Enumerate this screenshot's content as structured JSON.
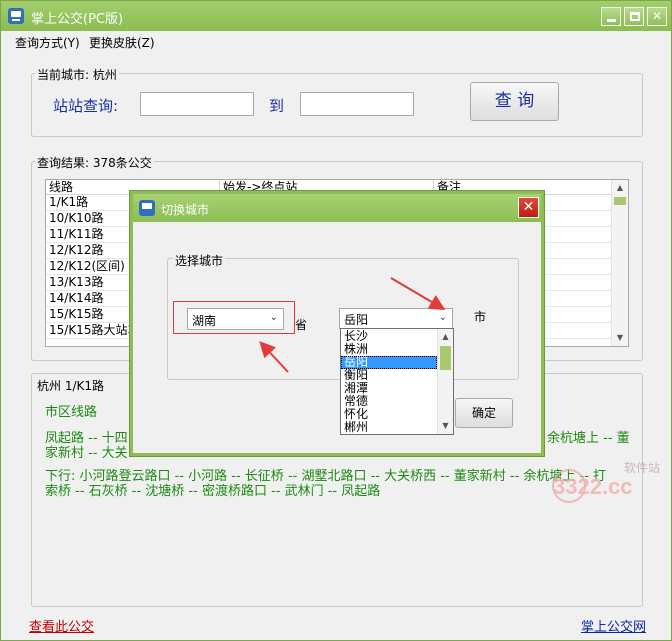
{
  "window": {
    "title": "掌上公交(PC版)"
  },
  "menu": [
    "查询方式(Y)",
    "更换皮肤(Z)"
  ],
  "current_city": {
    "legend": "当前城市: 杭州",
    "station_label": "站站查询:",
    "to_label": "到",
    "from_value": "",
    "to_value": "",
    "query_button": "查 询"
  },
  "results": {
    "legend": "查询结果: 378条公交",
    "columns": [
      "线路",
      "始发->终点站",
      "备注"
    ],
    "rows": [
      {
        "line": "1/K1路"
      },
      {
        "line": "10/K10路"
      },
      {
        "line": "11/K11路"
      },
      {
        "line": "12/K12路"
      },
      {
        "line": "12/K12(区间)"
      },
      {
        "line": "13/K13路"
      },
      {
        "line": "14/K14路"
      },
      {
        "line": "15/K15路"
      },
      {
        "line": "15/K15路大站车"
      }
    ]
  },
  "detail": {
    "legend": "杭州 1/K1路",
    "legend_extra": "〔",
    "district": "市区线路",
    "up_line1_left": "凤起路 -- 十四",
    "up_line2_left": "家新村 -- 大关",
    "up_line1_right": "余杭塘上 -- 董",
    "down_line1": "下行:    小河路登云路口 -- 小河路 -- 长征桥 -- 湖墅北路口 -- 大关桥西 -- 董家新村 -- 余杭塘上 -- 打",
    "down_line2": "索桥 -- 石灰桥 -- 沈塘桥 -- 密渡桥路口 -- 武林门 -- 凤起路"
  },
  "footer": {
    "view_link": "查看此公交",
    "brand_link": "掌上公交网"
  },
  "dialog": {
    "title": "切换城市",
    "group_label": "选择城市",
    "province_value": "湖南",
    "province_unit": "省",
    "city_value": "岳阳",
    "city_unit": "市",
    "confirm_button": "确定",
    "city_options": [
      "长沙",
      "株洲",
      "岳阳",
      "衡阳",
      "湘潭",
      "常德",
      "怀化",
      "郴州"
    ],
    "selected_index": 2
  },
  "watermark": {
    "brand": "3322.cc",
    "tag": "软件站"
  },
  "colors": {
    "titlebar": "#8bbd52",
    "green_text": "#1c8a12",
    "link_red": "#c00000",
    "annotation_red": "#e23b3b"
  }
}
